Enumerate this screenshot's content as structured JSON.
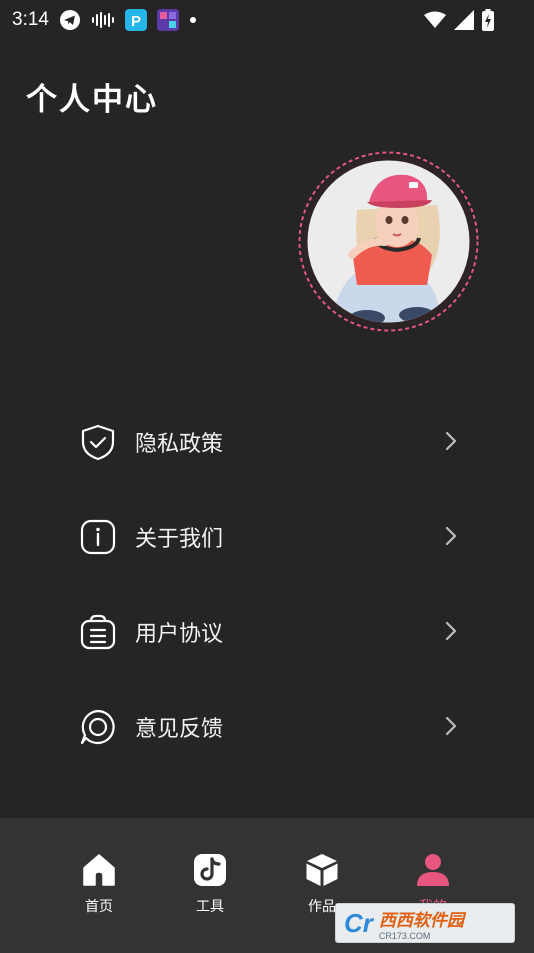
{
  "status_bar": {
    "time": "3:14",
    "icons": [
      "telegram-icon",
      "audio-wave-icon",
      "app-p-icon",
      "app-game-icon",
      "dot-icon"
    ],
    "right_icons": [
      "wifi-icon",
      "signal-icon",
      "battery-charging-icon"
    ]
  },
  "page_title": "个人中心",
  "avatar": {
    "description_icon": "user-avatar-girl",
    "ring_color": "#e8557f"
  },
  "menu": [
    {
      "id": "privacy",
      "label": "隐私政策",
      "icon": "shield-check-icon"
    },
    {
      "id": "about",
      "label": "关于我们",
      "icon": "info-icon"
    },
    {
      "id": "agreement",
      "label": "用户协议",
      "icon": "clipboard-icon"
    },
    {
      "id": "feedback",
      "label": "意见反馈",
      "icon": "chat-bubble-icon"
    }
  ],
  "bottom_nav": [
    {
      "id": "home",
      "label": "首页",
      "icon": "home-icon",
      "active": false
    },
    {
      "id": "tools",
      "label": "工具",
      "icon": "tiktok-tool-icon",
      "active": false
    },
    {
      "id": "works",
      "label": "作品",
      "icon": "cube-icon",
      "active": false
    },
    {
      "id": "mine",
      "label": "我的",
      "icon": "person-icon",
      "active": true
    }
  ],
  "colors": {
    "background": "#252525",
    "nav_background": "#333333",
    "accent": "#e8557f"
  },
  "watermark": {
    "logo": "Cr",
    "main": "西西软件园",
    "sub": "CR173.COM"
  }
}
